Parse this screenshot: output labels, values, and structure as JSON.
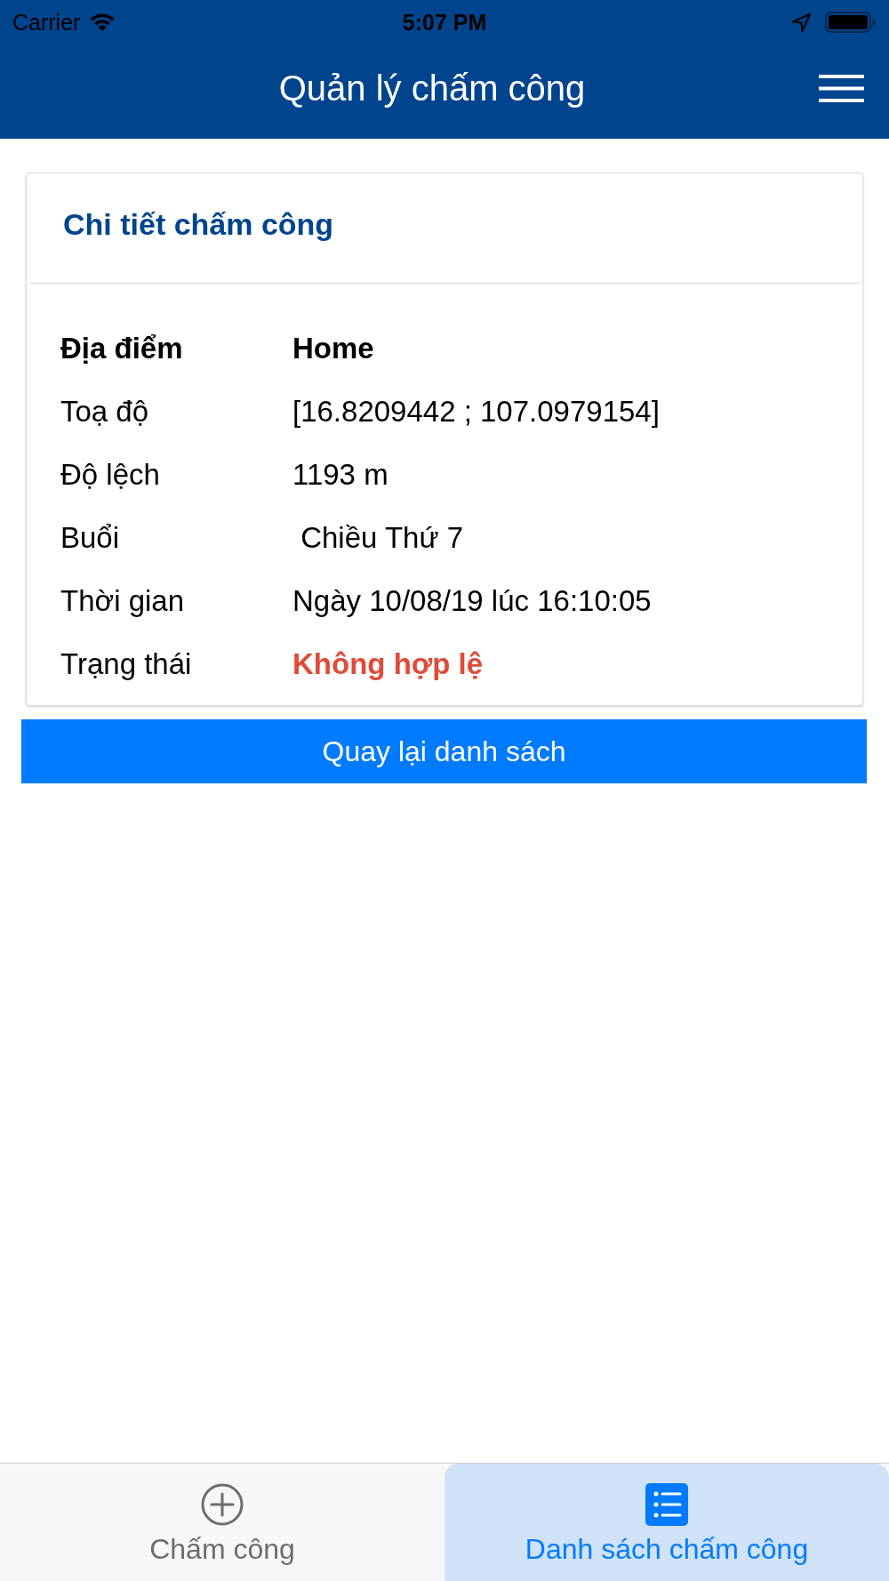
{
  "status_bar": {
    "carrier": "Carrier",
    "time": "5:07 PM"
  },
  "header": {
    "title": "Quản lý chấm công"
  },
  "card": {
    "title": "Chi tiết chấm công",
    "rows": [
      {
        "kind": "bold",
        "label": "Địa điểm",
        "value": "Home"
      },
      {
        "kind": "plain",
        "label": "Toạ độ",
        "value": "[16.8209442 ; 107.0979154]"
      },
      {
        "kind": "plain",
        "label": "Độ lệch",
        "value": "1193 m"
      },
      {
        "kind": "plain",
        "label": "Buổi",
        "value": " Chiều Thứ 7"
      },
      {
        "kind": "plain",
        "label": "Thời gian",
        "value": "Ngày 10/08/19 lúc 16:10:05"
      },
      {
        "kind": "status",
        "label": "Trạng thái",
        "value": "Không hợp lệ"
      }
    ]
  },
  "back_button": {
    "label": "Quay lại danh sách"
  },
  "tab_bar": {
    "tabs": [
      {
        "kind": "add",
        "label": "Chấm công",
        "selected": false
      },
      {
        "kind": "list",
        "label": "Danh sách chấm công",
        "selected": true
      }
    ]
  }
}
